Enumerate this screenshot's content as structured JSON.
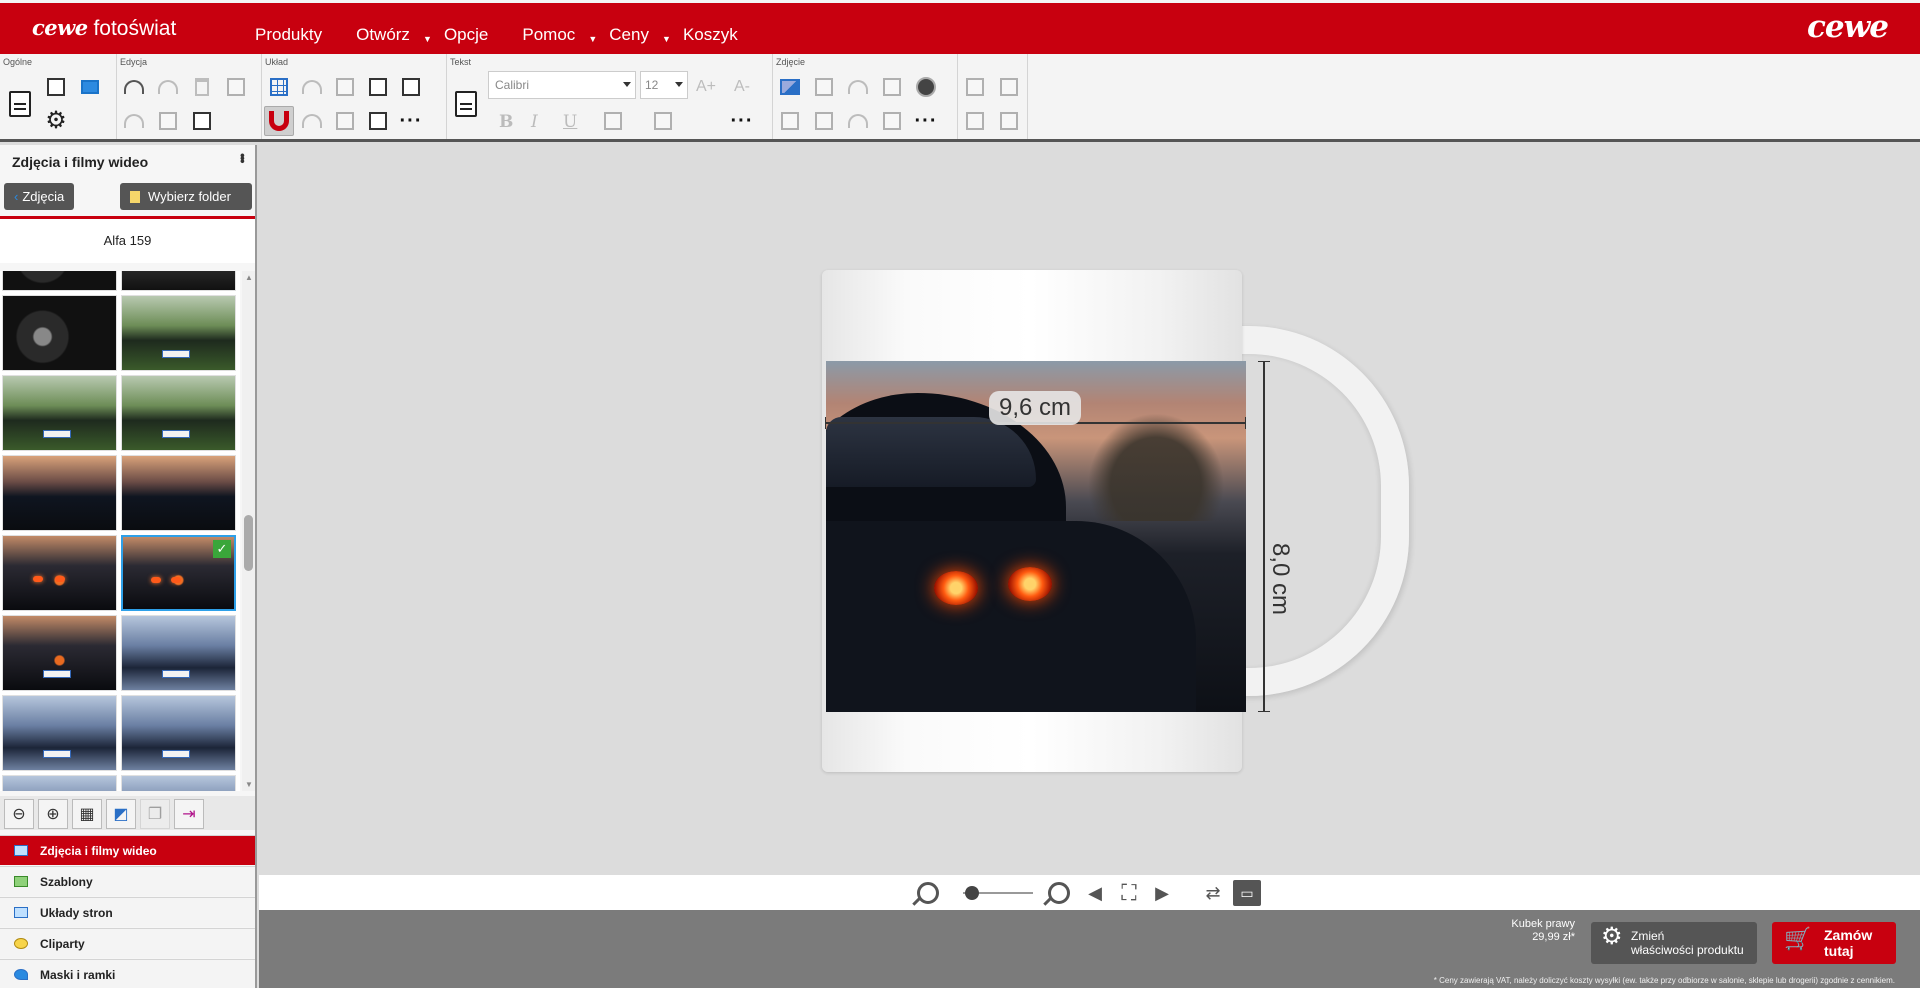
{
  "header": {
    "logo_left_brand": "cewe",
    "logo_left_text": "fotoświat",
    "logo_right": "cewe",
    "nav": [
      {
        "label": "Produkty",
        "dropdown": false
      },
      {
        "label": "Otwórz",
        "dropdown": true
      },
      {
        "label": "Opcje",
        "dropdown": false
      },
      {
        "label": "Pomoc",
        "dropdown": true
      },
      {
        "label": "Ceny",
        "dropdown": true
      },
      {
        "label": "Koszyk",
        "dropdown": false
      }
    ]
  },
  "toolbar": {
    "groups": {
      "general": "Ogólne",
      "edit": "Edycja",
      "layout": "Układ",
      "text": "Tekst",
      "photo": "Zdjęcie",
      "extra": ""
    },
    "font_family": "Calibri",
    "font_size": "12",
    "text_format": {
      "bold": "B",
      "italic": "I",
      "underline": "U"
    },
    "font_grow": "A+",
    "font_shrink": "A-"
  },
  "left_panel": {
    "title": "Zdjęcia i filmy wideo",
    "back_button": "Zdjęcia",
    "folder_button": "Wybierz folder",
    "folder_name": "Alfa 159",
    "bottom_tabs": [
      {
        "label": "Zdjęcia i filmy wideo",
        "active": true
      },
      {
        "label": "Szablony",
        "active": false
      },
      {
        "label": "Układy stron",
        "active": false
      },
      {
        "label": "Cliparty",
        "active": false
      },
      {
        "label": "Maski i ramki",
        "active": false
      }
    ]
  },
  "canvas": {
    "width_label": "9,6 cm",
    "height_label": "8,0 cm"
  },
  "bottom": {
    "product_name": "Kubek prawy",
    "product_price": "29,99 zł*",
    "change_button_line1": "Zmień",
    "change_button_line2": "właściwości produktu",
    "order_button_line1": "Zamów",
    "order_button_line2": "tutaj",
    "vat_note": "* Ceny zawierają VAT, należy doliczyć koszty wysyłki (ew. także przy odbiorze w salonie, sklepie lub drogerii) zgodnie z cennikiem."
  },
  "colors": {
    "brand_red": "#c8000f",
    "panel_dark": "#555555",
    "selection_blue": "#2ea0e8"
  }
}
